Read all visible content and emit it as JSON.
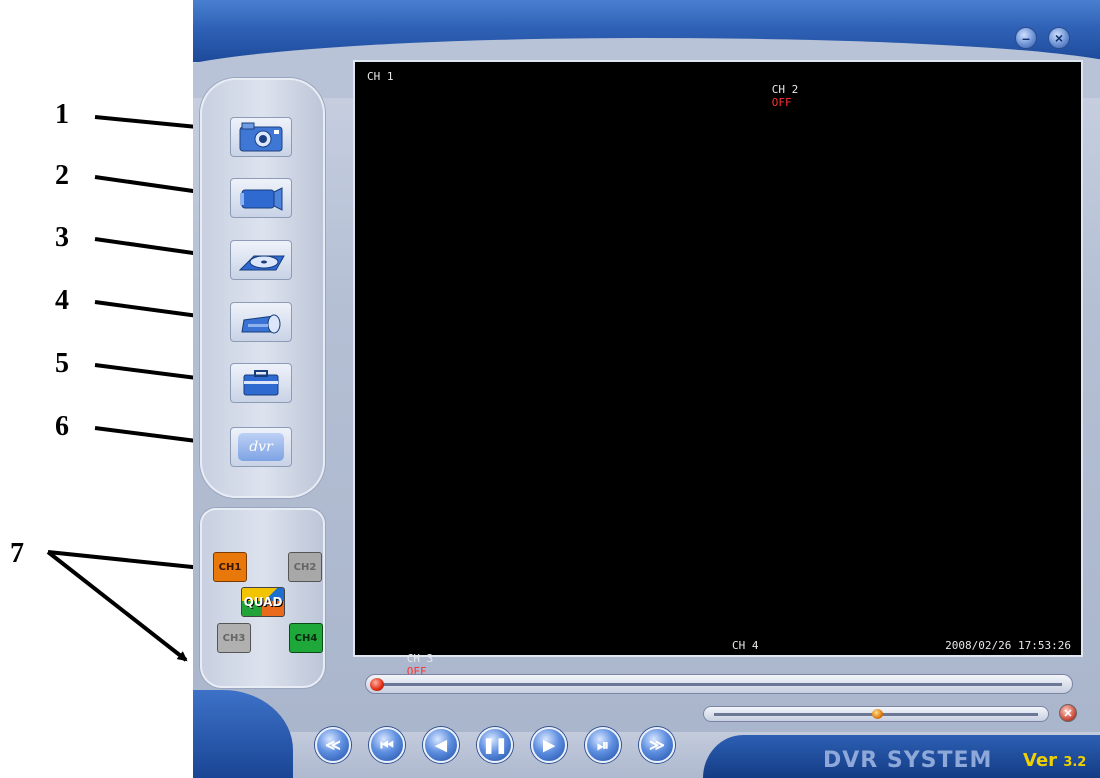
{
  "annotations": [
    "1",
    "2",
    "3",
    "4",
    "5",
    "6",
    "7"
  ],
  "window": {
    "minimize_icon": "minimize-icon",
    "close_icon": "close-icon"
  },
  "toolbar": {
    "items": [
      {
        "name": "snapshot-button",
        "icon": "camera-icon"
      },
      {
        "name": "record-button",
        "icon": "video-camera-icon"
      },
      {
        "name": "playback-button",
        "icon": "disc-icon"
      },
      {
        "name": "print-button",
        "icon": "printer-icon"
      },
      {
        "name": "settings-button",
        "icon": "briefcase-icon"
      },
      {
        "name": "dvr-button",
        "icon": "dvr-logo-icon",
        "label": "dvr"
      }
    ]
  },
  "channels": {
    "ch1": "CH1",
    "ch2": "CH2",
    "quad": "QUAD",
    "ch3": "CH3",
    "ch4": "CH4",
    "colors": {
      "ch1": "#e8780a",
      "ch2": "#a8a8a8",
      "ch3": "#b0b0b0",
      "ch4": "#1fa83a"
    }
  },
  "video": {
    "ch1_label": "CH 1",
    "ch2_label": "CH 2",
    "ch2_status": "OFF",
    "ch3_label": "CH 3",
    "ch3_status": "OFF",
    "ch4_label": "CH 4",
    "timestamp": "2008/02/26 17:53:26"
  },
  "playback": {
    "progress": 0.0,
    "volume": 0.5,
    "buttons": [
      "fast-rewind",
      "previous",
      "play-reverse",
      "pause",
      "play",
      "step-forward",
      "fast-forward"
    ]
  },
  "branding": {
    "title": "DVR SYSTEM",
    "version_prefix": "Ver",
    "version": "3.2"
  }
}
